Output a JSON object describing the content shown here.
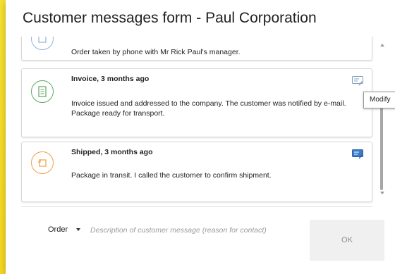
{
  "dialog": {
    "title": "Customer messages form - Paul Corporation"
  },
  "messages": [
    {
      "header": "",
      "text": "Order taken by phone with Mr Rick Paul's manager.",
      "icon": "order-icon",
      "color": "#8fb3d9"
    },
    {
      "header": "Invoice, 3 months ago",
      "text": "Invoice issued and addressed to the company. The customer was notified by e-mail. Package ready for transport.",
      "icon": "invoice-icon",
      "color": "#5fa862"
    },
    {
      "header": "Shipped, 3 months ago",
      "text": "Package in transit. I called the customer to confirm shipment.",
      "icon": "shipped-icon",
      "color": "#f0a048"
    }
  ],
  "tooltip": {
    "text": "Modify"
  },
  "footer": {
    "type_label": "Order",
    "description_placeholder": "Description of customer message (reason for contact)",
    "ok_label": "OK"
  },
  "colors": {
    "background": "#f5d820",
    "edit_icon": "#3a7cc9"
  }
}
